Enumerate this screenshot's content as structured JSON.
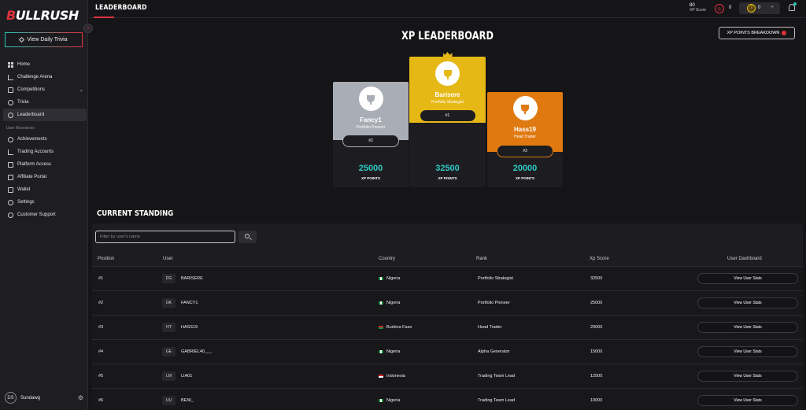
{
  "brand": {
    "logo_b": "B",
    "logo_rest": "ULLRUSH"
  },
  "sidebar": {
    "trivia_button": "View Daily Trivia",
    "items": [
      {
        "label": "Home",
        "icon": "home-icon"
      },
      {
        "label": "Challenge Arena",
        "icon": "arena-icon"
      },
      {
        "label": "Competitions",
        "icon": "chart-icon",
        "has_submenu": true
      },
      {
        "label": "Trivia",
        "icon": "help-circle-icon"
      },
      {
        "label": "Leaderboard",
        "icon": "trophy-icon",
        "active": true
      }
    ],
    "section_label": "User Resources",
    "resource_items": [
      {
        "label": "Achievements",
        "icon": "medal-icon"
      },
      {
        "label": "Trading Accounts",
        "icon": "trend-icon"
      },
      {
        "label": "Platform Access",
        "icon": "external-icon"
      },
      {
        "label": "Affiliate Portal",
        "icon": "share-icon"
      },
      {
        "label": "Wallet",
        "icon": "wallet-icon"
      },
      {
        "label": "Settings",
        "icon": "gear-icon"
      },
      {
        "label": "Customer Support",
        "icon": "support-icon"
      }
    ],
    "user": {
      "initials": "DS",
      "name": "Sundawg"
    }
  },
  "header": {
    "title": "LEADERBOARD",
    "xp_value": "80",
    "xp_label": "XP Score",
    "tickets_count": "0",
    "coins_count": "0",
    "plus": "+"
  },
  "leaderboard": {
    "title": "XP LEADERBOARD",
    "breakdown_button": "XP POINTS BREAKDOWN",
    "points_label": "XP POINTS",
    "podium": {
      "first": {
        "name": "Barisere",
        "rank": "Portfolio Strategist",
        "position": "#1",
        "score": "32500"
      },
      "second": {
        "name": "Fancy1",
        "rank": "Portfolio Pioneer",
        "position": "#2",
        "score": "25000"
      },
      "third": {
        "name": "Hass19",
        "rank": "Head Trader",
        "position": "#3",
        "score": "20000"
      }
    }
  },
  "standing": {
    "title": "CURRENT STANDING",
    "search_placeholder": "Filter by user's name",
    "columns": [
      "Position",
      "User",
      "Country",
      "Rank",
      "Xp Score",
      "User Dashboard"
    ],
    "view_button": "View User Stats",
    "rows": [
      {
        "position": "#1",
        "initials": "DG",
        "user": "BARISERE",
        "country": "Nigeria",
        "flag": "nigeria",
        "rank": "Portfolio Strategist",
        "score": "32500"
      },
      {
        "position": "#2",
        "initials": "OK",
        "user": "FANCY1",
        "country": "Nigeria",
        "flag": "nigeria",
        "rank": "Portfolio Pioneer",
        "score": "25000"
      },
      {
        "position": "#3",
        "initials": "HT",
        "user": "HASS19",
        "country": "Burkina Faso",
        "flag": "burkina",
        "rank": "Head Trader",
        "score": "20000"
      },
      {
        "position": "#4",
        "initials": "GE",
        "user": "GABRIEL40___",
        "country": "Nigeria",
        "flag": "nigeria",
        "rank": "Alpha Generator",
        "score": "15000"
      },
      {
        "position": "#5",
        "initials": "LM",
        "user": "LIA01",
        "country": "Indonesia",
        "flag": "indonesia",
        "rank": "Trading Team Lead",
        "score": "12500"
      },
      {
        "position": "#6",
        "initials": "UU",
        "user": "BENI_",
        "country": "Nigeria",
        "flag": "nigeria",
        "rank": "Trading Team Lead",
        "score": "10000"
      }
    ]
  },
  "colors": {
    "accent_red": "#e0313c",
    "teal": "#2ec9c4",
    "gold": "#e6b816",
    "silver": "#a9adb5",
    "bronze": "#e07a10"
  }
}
